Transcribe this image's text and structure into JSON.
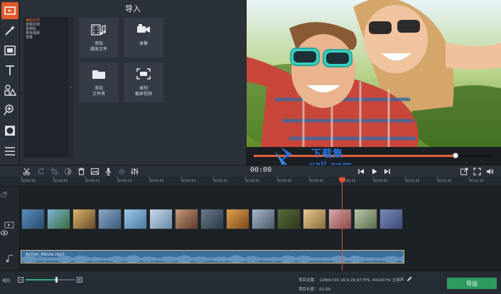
{
  "import_panel": {
    "title": "导入",
    "categories": [
      "我的文件",
      "音频示例",
      "音频轨",
      "库存视频",
      "背景"
    ],
    "tiles": [
      {
        "label": "添加\n媒体文件",
        "icon": "add-media-icon"
      },
      {
        "label": "录像",
        "icon": "video-camera-icon"
      },
      {
        "label": "添加\n文件夹",
        "icon": "folder-icon"
      },
      {
        "label": "录制\n截屏视频",
        "icon": "screen-capture-icon"
      }
    ]
  },
  "preview": {
    "progress": 0.84
  },
  "timeline_toolbar": {
    "time_readout": "00:00"
  },
  "ruler": {
    "ticks": [
      "00:00:00",
      "00:00:05",
      "00:00:10",
      "00:00:15",
      "00:00:20",
      "00:00:25",
      "00:00:30",
      "00:00:35",
      "00:00:40",
      "00:00:45",
      "00:00:50",
      "00:00:55",
      "00:01:00",
      "00:01:05",
      "00:01:10"
    ]
  },
  "audio_track": {
    "clip_name": "Action_Movie.mp3"
  },
  "status": {
    "zoom_label": "缩放:",
    "zoom_level": 0.62,
    "project_settings": "项目设置：  1280x720 16:9 29.97 FPS, 44100 Hz 立体声",
    "project_length": "项目长度：  01:00",
    "export_label": "导出"
  },
  "watermark": {
    "line1": "下载集",
    "line2": "xzji.com"
  },
  "colors": {
    "accent": "#e05a2a",
    "export": "#2f9a5e",
    "audio_clip": "#3e6f9c",
    "playhead": "#e0503a"
  }
}
